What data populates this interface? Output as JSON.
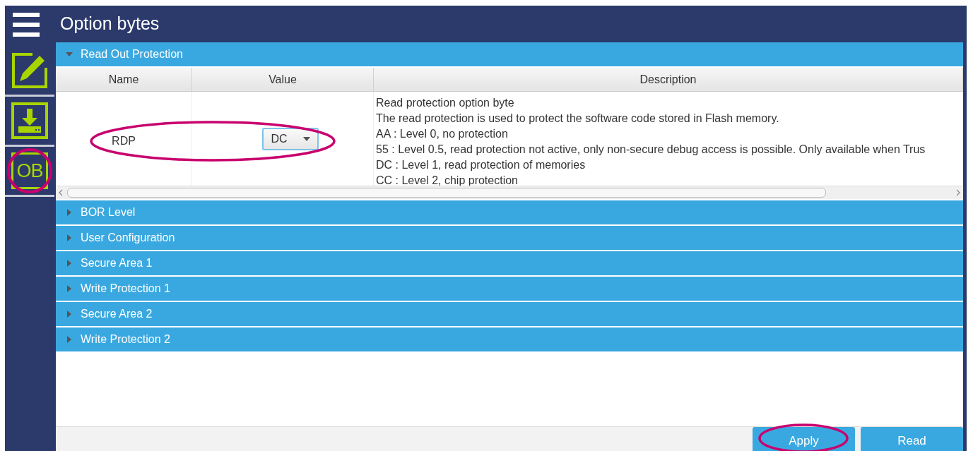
{
  "window": {
    "title": "Option bytes"
  },
  "sidebar": {
    "items": [
      {
        "kind": "edit",
        "highlighted": false
      },
      {
        "kind": "download",
        "highlighted": false
      },
      {
        "kind": "text",
        "label": "OB",
        "highlighted": true
      }
    ]
  },
  "sections": [
    {
      "title": "Read Out Protection",
      "expanded": true,
      "table": {
        "columns": [
          "Name",
          "Value",
          "Description"
        ],
        "rows": [
          {
            "name": "RDP",
            "value": "DC",
            "highlighted": true,
            "description": [
              "Read protection option byte",
              "The read protection is used to protect the software code stored in Flash memory.",
              "AA : Level 0, no protection",
              "55 : Level 0.5, read protection not active, only non-secure debug access is possible. Only available when Trus",
              "DC : Level 1, read protection of memories",
              "CC : Level 2, chip protection"
            ]
          }
        ]
      }
    },
    {
      "title": "BOR Level",
      "expanded": false
    },
    {
      "title": "User Configuration",
      "expanded": false
    },
    {
      "title": "Secure Area 1",
      "expanded": false
    },
    {
      "title": "Write Protection 1",
      "expanded": false
    },
    {
      "title": "Secure Area 2",
      "expanded": false
    },
    {
      "title": "Write Protection 2",
      "expanded": false
    }
  ],
  "buttons": [
    {
      "label": "Apply",
      "highlighted": true
    },
    {
      "label": "Read",
      "highlighted": false
    }
  ]
}
